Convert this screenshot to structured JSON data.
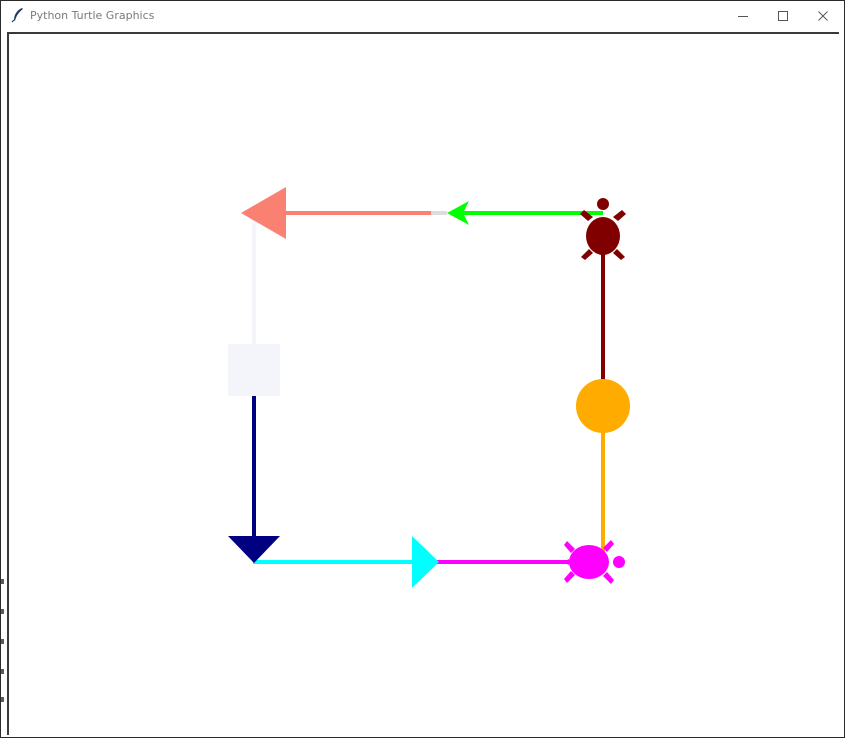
{
  "window": {
    "title": "Python Turtle Graphics",
    "app_icon": "feather-icon",
    "controls": [
      {
        "name": "minimize-button",
        "icon": "minimize-icon"
      },
      {
        "name": "maximize-button",
        "icon": "maximize-icon"
      },
      {
        "name": "close-button",
        "icon": "close-icon"
      }
    ]
  },
  "canvas": {
    "background": "#ffffff"
  },
  "colors": {
    "salmon": "#fa8072",
    "lime": "#00ff00",
    "maroon": "#800000",
    "orange": "#ffab00",
    "magenta": "#ff00ff",
    "cyan": "#00ffff",
    "navy": "#000080",
    "ghostwhite": "#f4f5fa",
    "gray_segment": "#dddddd"
  },
  "turtles": [
    {
      "name": "salmon-arrow-turtle",
      "shape": "arrow",
      "color": "#fa8072",
      "heading": "west"
    },
    {
      "name": "lime-classic-turtle",
      "shape": "classic",
      "color": "#00ff00",
      "heading": "west"
    },
    {
      "name": "maroon-turtle-turtle",
      "shape": "turtle",
      "color": "#800000",
      "heading": "north"
    },
    {
      "name": "orange-circle-turtle",
      "shape": "circle",
      "color": "#ffab00",
      "heading": "north"
    },
    {
      "name": "magenta-turtle-turtle",
      "shape": "turtle",
      "color": "#ff00ff",
      "heading": "east"
    },
    {
      "name": "cyan-triangle-turtle",
      "shape": "triangle",
      "color": "#00ffff",
      "heading": "east"
    },
    {
      "name": "navy-triangle-turtle",
      "shape": "triangle",
      "color": "#000080",
      "heading": "south"
    },
    {
      "name": "ghostwhite-square-turtle",
      "shape": "square",
      "color": "#f4f5fa",
      "heading": "south"
    }
  ]
}
